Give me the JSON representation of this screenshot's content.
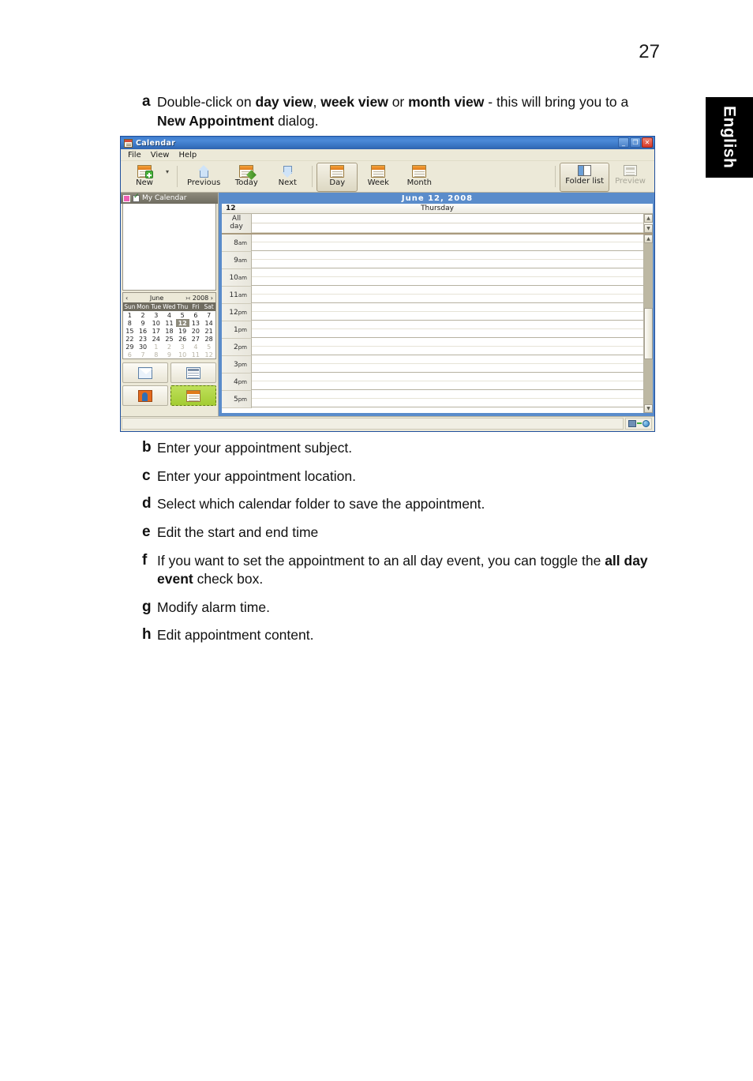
{
  "page": {
    "number": "27",
    "language_tab": "English"
  },
  "intro": {
    "letter": "a",
    "line1_pre": "Double-click on ",
    "line1_b1": "day view",
    "line1_mid1": ", ",
    "line1_b2": "week view",
    "line1_mid2": " or ",
    "line1_b3": "month view",
    "line1_post": " - this will",
    "line2_pre": "bring you to a ",
    "line2_b1": "New Appointment",
    "line2_post": " dialog."
  },
  "steps": [
    {
      "letter": "b",
      "text": "Enter your appointment subject."
    },
    {
      "letter": "c",
      "text": "Enter your appointment location."
    },
    {
      "letter": "d",
      "text": "Select which calendar folder to save the appointment."
    },
    {
      "letter": "e",
      "text": "Edit the start and end time"
    },
    {
      "letter": "f",
      "text_pre": "If you want to set the appointment to an all day event, you can toggle the ",
      "text_bold": "all day event",
      "text_post": " check box."
    },
    {
      "letter": "g",
      "text": "Modify alarm time."
    },
    {
      "letter": "h",
      "text": "Edit appointment content."
    }
  ],
  "app": {
    "title": "Calendar",
    "window_buttons": {
      "minimize": "_",
      "restore": "❐",
      "close": "✕"
    },
    "menu": [
      "File",
      "View",
      "Help"
    ],
    "toolbar": {
      "new": "New",
      "previous": "Previous",
      "today": "Today",
      "next": "Next",
      "day": "Day",
      "week": "Week",
      "month": "Month",
      "folder_list": "Folder list",
      "preview": "Preview"
    },
    "sidebar": {
      "folder_name": "My Calendar",
      "mini_calendar": {
        "prev_month": "‹",
        "month": "June",
        "next_month": "›",
        "prev_year": "‹",
        "year": "2008",
        "next_year": "›",
        "weekdays": [
          "Sun",
          "Mon",
          "Tue",
          "Wed",
          "Thu",
          "Fri",
          "Sat"
        ],
        "weeks": [
          [
            {
              "d": "1",
              "m": false
            },
            {
              "d": "2",
              "m": false
            },
            {
              "d": "3",
              "m": false
            },
            {
              "d": "4",
              "m": false
            },
            {
              "d": "5",
              "m": false
            },
            {
              "d": "6",
              "m": false
            },
            {
              "d": "7",
              "m": false
            }
          ],
          [
            {
              "d": "8",
              "m": false
            },
            {
              "d": "9",
              "m": false
            },
            {
              "d": "10",
              "m": false
            },
            {
              "d": "11",
              "m": false
            },
            {
              "d": "12",
              "m": false,
              "today": true
            },
            {
              "d": "13",
              "m": false
            },
            {
              "d": "14",
              "m": false
            }
          ],
          [
            {
              "d": "15",
              "m": false
            },
            {
              "d": "16",
              "m": false
            },
            {
              "d": "17",
              "m": false
            },
            {
              "d": "18",
              "m": false
            },
            {
              "d": "19",
              "m": false
            },
            {
              "d": "20",
              "m": false
            },
            {
              "d": "21",
              "m": false
            }
          ],
          [
            {
              "d": "22",
              "m": false
            },
            {
              "d": "23",
              "m": false
            },
            {
              "d": "24",
              "m": false
            },
            {
              "d": "25",
              "m": false
            },
            {
              "d": "26",
              "m": false
            },
            {
              "d": "27",
              "m": false
            },
            {
              "d": "28",
              "m": false
            }
          ],
          [
            {
              "d": "29",
              "m": false
            },
            {
              "d": "30",
              "m": false
            },
            {
              "d": "1",
              "m": true
            },
            {
              "d": "2",
              "m": true
            },
            {
              "d": "3",
              "m": true
            },
            {
              "d": "4",
              "m": true
            },
            {
              "d": "5",
              "m": true
            }
          ],
          [
            {
              "d": "6",
              "m": true
            },
            {
              "d": "7",
              "m": true
            },
            {
              "d": "8",
              "m": true
            },
            {
              "d": "9",
              "m": true
            },
            {
              "d": "10",
              "m": true
            },
            {
              "d": "11",
              "m": true
            },
            {
              "d": "12",
              "m": true
            }
          ]
        ]
      },
      "shortcuts": [
        "mail",
        "news",
        "contacts",
        "calendar"
      ]
    },
    "dayview": {
      "date_banner": "June  12,  2008",
      "day_number": "12",
      "day_name": "Thursday",
      "all_day_label_line1": "All",
      "all_day_label_line2": "day",
      "hours": [
        {
          "h": "8",
          "ap": "am"
        },
        {
          "h": "9",
          "ap": "am"
        },
        {
          "h": "10",
          "ap": "am"
        },
        {
          "h": "11",
          "ap": "am"
        },
        {
          "h": "12",
          "ap": "pm"
        },
        {
          "h": "1",
          "ap": "pm"
        },
        {
          "h": "2",
          "ap": "pm"
        },
        {
          "h": "3",
          "ap": "pm"
        },
        {
          "h": "4",
          "ap": "pm"
        },
        {
          "h": "5",
          "ap": "pm"
        }
      ]
    },
    "colors": {
      "title_bar": "#3d7ccc",
      "banner": "#5a8ccb",
      "folder_swatch": "#ef5fb4",
      "active_shortcut": "#a3cc33",
      "toolbar_bg": "#ece9d8"
    }
  }
}
